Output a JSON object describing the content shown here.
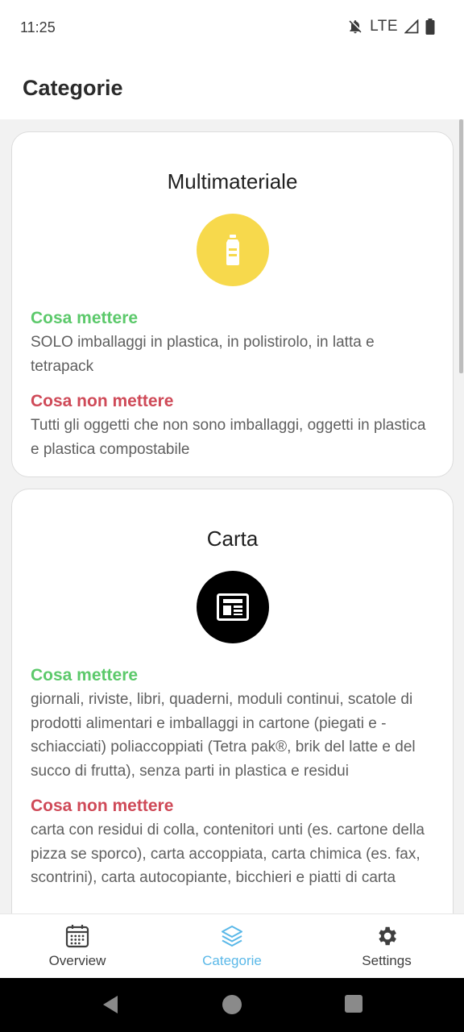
{
  "status_bar": {
    "time": "11:25",
    "network": "LTE"
  },
  "app_bar": {
    "title": "Categorie"
  },
  "cards": [
    {
      "title": "Multimateriale",
      "icon": "bottle-icon",
      "icon_color": "#f7d94c",
      "what_to_put_heading": "Cosa mettere",
      "what_to_put_text": "SOLO imballaggi in plastica, in polistirolo, in latta e tetrapack",
      "what_not_to_put_heading": "Cosa non mettere",
      "what_not_to_put_text": "Tutti gli oggetti che non sono imballaggi, oggetti in plastica e plastica compostabile"
    },
    {
      "title": "Carta",
      "icon": "newspaper-icon",
      "icon_color": "#000000",
      "what_to_put_heading": "Cosa mettere",
      "what_to_put_text": "giornali, riviste, libri, quaderni, moduli continui, scatole di prodotti alimentari e imballaggi in cartone (piegati e - schiacciati) poliaccoppiati (Tetra pak®, brik del latte e del succo di frutta), senza parti in plastica e residui",
      "what_not_to_put_heading": "Cosa non mettere",
      "what_not_to_put_text": "carta con residui di colla, contenitori unti (es. cartone della pizza se sporco), carta accoppiata, carta chimica (es. fax, scontrini), carta autocopiante, bicchieri e piatti di carta"
    }
  ],
  "bottom_nav": {
    "items": [
      {
        "label": "Overview",
        "icon": "calendar-icon",
        "active": false
      },
      {
        "label": "Categorie",
        "icon": "layers-icon",
        "active": true
      },
      {
        "label": "Settings",
        "icon": "gear-icon",
        "active": false
      }
    ]
  },
  "colors": {
    "accent": "#5ab8e8",
    "ok_green": "#5cc96b",
    "no_red": "#cf4a58"
  }
}
